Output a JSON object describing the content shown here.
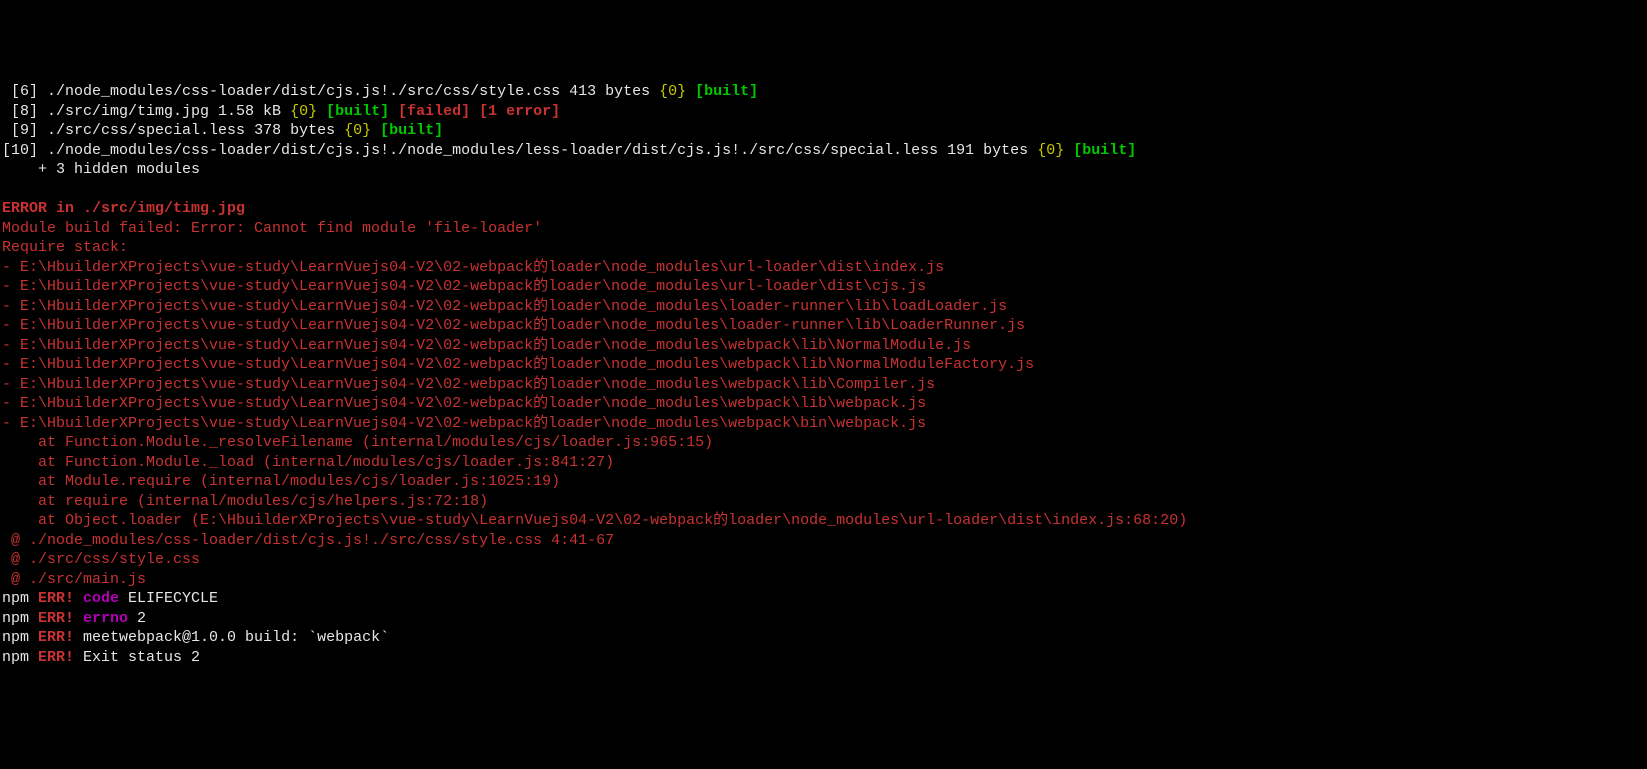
{
  "modules": [
    {
      "idx": " [6]",
      "path": " ./node_modules/css-loader/dist/cjs.js!./src/css/style.css",
      "size": " 413 bytes ",
      "stat": "{0}",
      "tags": [
        " ",
        "[built]"
      ]
    },
    {
      "idx": " [8]",
      "path": " ./src/img/timg.jpg",
      "size": " 1.58 kB ",
      "stat": "{0}",
      "tags": [
        " ",
        "[built]",
        " ",
        "[failed]",
        " ",
        "[1 error]"
      ]
    },
    {
      "idx": " [9]",
      "path": " ./src/css/special.less",
      "size": " 378 bytes ",
      "stat": "{0}",
      "tags": [
        " ",
        "[built]"
      ]
    },
    {
      "idx": "[10]",
      "path": " ./node_modules/css-loader/dist/cjs.js!./node_modules/less-loader/dist/cjs.js!./src/css/special.less",
      "size": " 191 bytes ",
      "stat": "{0}",
      "tags": [
        " ",
        "[built]"
      ]
    }
  ],
  "hidden": "    + 3 hidden modules",
  "blank": "",
  "err_header": "ERROR in ./src/img/timg.jpg",
  "err_msg": "Module build failed: Error: Cannot find module 'file-loader'",
  "req_stack_label": "Require stack:",
  "req_stack": [
    "- E:\\HbuilderXProjects\\vue-study\\LearnVuejs04-V2\\02-webpack的loader\\node_modules\\url-loader\\dist\\index.js",
    "- E:\\HbuilderXProjects\\vue-study\\LearnVuejs04-V2\\02-webpack的loader\\node_modules\\url-loader\\dist\\cjs.js",
    "- E:\\HbuilderXProjects\\vue-study\\LearnVuejs04-V2\\02-webpack的loader\\node_modules\\loader-runner\\lib\\loadLoader.js",
    "- E:\\HbuilderXProjects\\vue-study\\LearnVuejs04-V2\\02-webpack的loader\\node_modules\\loader-runner\\lib\\LoaderRunner.js",
    "- E:\\HbuilderXProjects\\vue-study\\LearnVuejs04-V2\\02-webpack的loader\\node_modules\\webpack\\lib\\NormalModule.js",
    "- E:\\HbuilderXProjects\\vue-study\\LearnVuejs04-V2\\02-webpack的loader\\node_modules\\webpack\\lib\\NormalModuleFactory.js",
    "- E:\\HbuilderXProjects\\vue-study\\LearnVuejs04-V2\\02-webpack的loader\\node_modules\\webpack\\lib\\Compiler.js",
    "- E:\\HbuilderXProjects\\vue-study\\LearnVuejs04-V2\\02-webpack的loader\\node_modules\\webpack\\lib\\webpack.js",
    "- E:\\HbuilderXProjects\\vue-study\\LearnVuejs04-V2\\02-webpack的loader\\node_modules\\webpack\\bin\\webpack.js"
  ],
  "at_lines": [
    "    at Function.Module._resolveFilename (internal/modules/cjs/loader.js:965:15)",
    "    at Function.Module._load (internal/modules/cjs/loader.js:841:27)",
    "    at Module.require (internal/modules/cjs/loader.js:1025:19)",
    "    at require (internal/modules/cjs/helpers.js:72:18)",
    "    at Object.loader (E:\\HbuilderXProjects\\vue-study\\LearnVuejs04-V2\\02-webpack的loader\\node_modules\\url-loader\\dist\\index.js:68:20)"
  ],
  "chain": [
    " @ ./node_modules/css-loader/dist/cjs.js!./src/css/style.css 4:41-67",
    " @ ./src/css/style.css",
    " @ ./src/main.js"
  ],
  "npm": [
    {
      "pre": "npm ",
      "err": "ERR!",
      "key": " code",
      "val": " ELIFECYCLE"
    },
    {
      "pre": "npm ",
      "err": "ERR!",
      "key": " errno",
      "val": " 2"
    },
    {
      "pre": "npm ",
      "err": "ERR!",
      "key": "",
      "val": " meetwebpack@1.0.0 build: `webpack`"
    },
    {
      "pre": "npm ",
      "err": "ERR!",
      "key": "",
      "val": " Exit status 2"
    }
  ]
}
